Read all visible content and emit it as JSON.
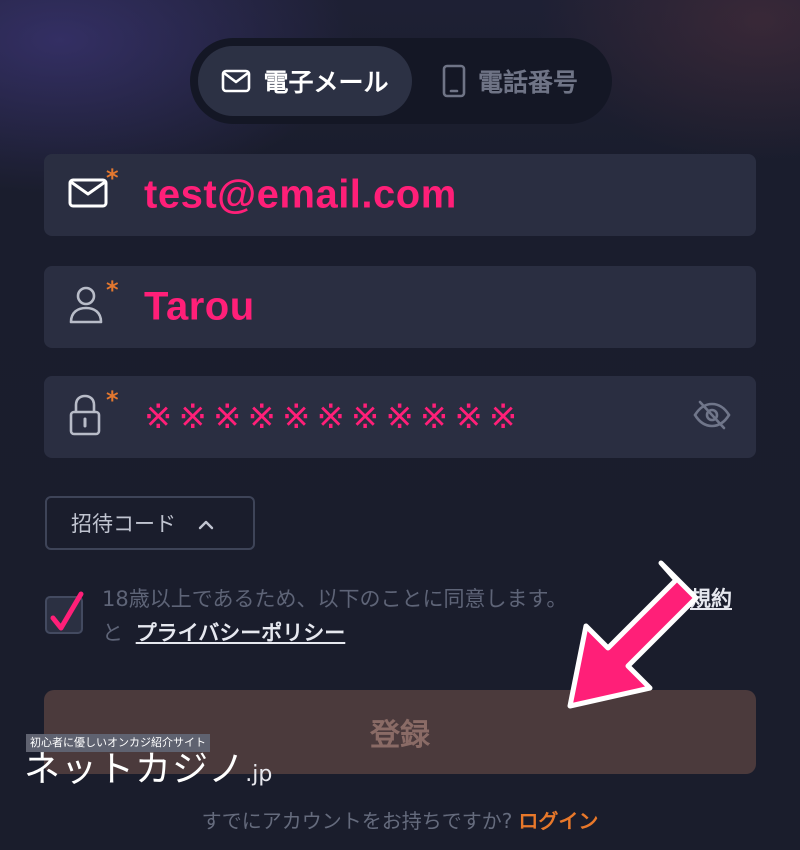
{
  "tabs": {
    "email_label": "電子メール",
    "phone_label": "電話番号"
  },
  "fields": {
    "email": {
      "required_mark": "*",
      "value": "test@email.com"
    },
    "username": {
      "required_mark": "*",
      "value": "Tarou"
    },
    "password": {
      "required_mark": "*",
      "value": "※※※※※※※※※※※"
    }
  },
  "invite_code": {
    "label": "招待コード"
  },
  "consent": {
    "text_line1": "18歳以上であるため、以下のことに同意します。",
    "terms_link": "規約",
    "text_line2_prefix": "と",
    "privacy_link": "プライバシーポリシー"
  },
  "register_button": {
    "label": "登録"
  },
  "watermark": {
    "tagline": "初心者に優しいオンカジ紹介サイト",
    "brand": "ネットカジノ",
    "domain": ".jp"
  },
  "login_prompt": {
    "text": "すでにアカウントをお持ちですか?",
    "link": "ログイン"
  },
  "colors": {
    "accent": "#ff1f78",
    "required": "#e4782f",
    "login_link": "#e8782a",
    "field_bg": "#2a2e41"
  },
  "icons": [
    "mail-icon",
    "phone-icon",
    "user-icon",
    "lock-icon",
    "eye-off-icon",
    "chevron-up-icon",
    "check-icon",
    "arrow-annotation"
  ]
}
